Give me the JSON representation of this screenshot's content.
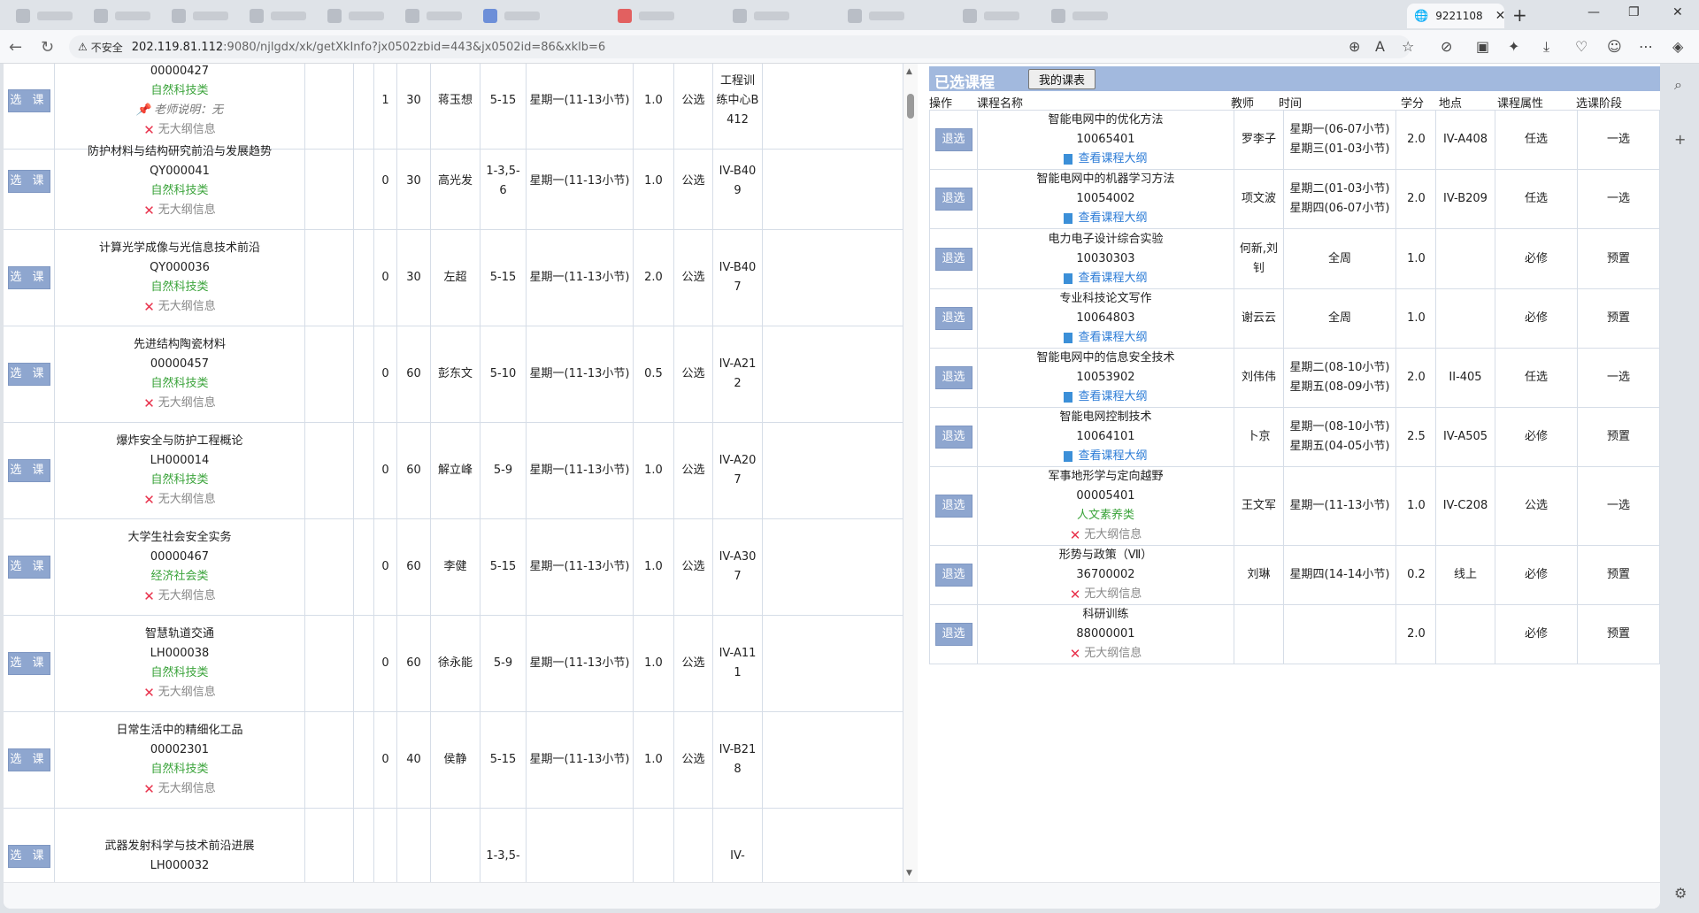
{
  "browser": {
    "active_tab_title": "9221108",
    "security_label": "不安全",
    "url_host": "202.119.81.112",
    "url_rest": ":9080/njlgdx/xk/getXkInfo?jx0502zbid=443&jx0502id=86&xklb=6"
  },
  "left_list": {
    "select_label": "选 课",
    "no_outline": "无大纲信息",
    "rows": [
      {
        "name": "",
        "code": "00000427",
        "category": "自然科技类",
        "note": "老师说明：无",
        "selected": "1",
        "capacity": "30",
        "teacher": "蒋玉想",
        "weeks": "5-15",
        "time": "星期一(11-13小节)",
        "credit": "1.0",
        "attr": "公选",
        "location": "工程训练中心B412"
      },
      {
        "name": "防护材料与结构研究前沿与发展趋势",
        "code": "QY000041",
        "category": "自然科技类",
        "note": "",
        "selected": "0",
        "capacity": "30",
        "teacher": "高光发",
        "weeks": "1-3,5-6",
        "time": "星期一(11-13小节)",
        "credit": "1.0",
        "attr": "公选",
        "location": "IV-B409"
      },
      {
        "name": "计算光学成像与光信息技术前沿",
        "code": "QY000036",
        "category": "自然科技类",
        "note": "",
        "selected": "0",
        "capacity": "30",
        "teacher": "左超",
        "weeks": "5-15",
        "time": "星期一(11-13小节)",
        "credit": "2.0",
        "attr": "公选",
        "location": "IV-B407"
      },
      {
        "name": "先进结构陶瓷材料",
        "code": "00000457",
        "category": "自然科技类",
        "note": "",
        "selected": "0",
        "capacity": "60",
        "teacher": "彭东文",
        "weeks": "5-10",
        "time": "星期一(11-13小节)",
        "credit": "0.5",
        "attr": "公选",
        "location": "IV-A212"
      },
      {
        "name": "爆炸安全与防护工程概论",
        "code": "LH000014",
        "category": "自然科技类",
        "note": "",
        "selected": "0",
        "capacity": "60",
        "teacher": "解立峰",
        "weeks": "5-9",
        "time": "星期一(11-13小节)",
        "credit": "1.0",
        "attr": "公选",
        "location": "IV-A207"
      },
      {
        "name": "大学生社会安全实务",
        "code": "00000467",
        "category": "经济社会类",
        "note": "",
        "selected": "0",
        "capacity": "60",
        "teacher": "李健",
        "weeks": "5-15",
        "time": "星期一(11-13小节)",
        "credit": "1.0",
        "attr": "公选",
        "location": "IV-A307"
      },
      {
        "name": "智慧轨道交通",
        "code": "LH000038",
        "category": "自然科技类",
        "note": "",
        "selected": "0",
        "capacity": "60",
        "teacher": "徐永能",
        "weeks": "5-9",
        "time": "星期一(11-13小节)",
        "credit": "1.0",
        "attr": "公选",
        "location": "IV-A111"
      },
      {
        "name": "日常生活中的精细化工品",
        "code": "00002301",
        "category": "自然科技类",
        "note": "",
        "selected": "0",
        "capacity": "40",
        "teacher": "侯静",
        "weeks": "5-15",
        "time": "星期一(11-13小节)",
        "credit": "1.0",
        "attr": "公选",
        "location": "IV-B218"
      },
      {
        "name": "武器发射科学与技术前沿进展",
        "code": "LH000032",
        "category": "",
        "note": "",
        "selected": "",
        "capacity": "",
        "teacher": "",
        "weeks": "1-3,5-",
        "time": "",
        "credit": "",
        "attr": "",
        "location": "IV-"
      }
    ]
  },
  "selected_panel": {
    "title": "已选课程",
    "my_schedule_button": "我的课表",
    "headers": {
      "op": "操作",
      "name": "课程名称",
      "teacher": "教师",
      "time": "时间",
      "credit": "学分",
      "location": "地点",
      "attr": "课程属性",
      "stage": "选课阶段"
    },
    "drop_label": "退选",
    "view_outline": "查看课程大纲",
    "no_outline": "无大纲信息",
    "rows": [
      {
        "name": "智能电网中的优化方法",
        "code": "10065401",
        "extra": "outline",
        "teacher": "罗李子",
        "time1": "星期一(06-07小节)",
        "time2": "星期三(01-03小节)",
        "credit": "2.0",
        "location": "IV-A408",
        "attr": "任选",
        "stage": "一选"
      },
      {
        "name": "智能电网中的机器学习方法",
        "code": "10054002",
        "extra": "outline",
        "teacher": "项文波",
        "time1": "星期二(01-03小节)",
        "time2": "星期四(06-07小节)",
        "credit": "2.0",
        "location": "IV-B209",
        "attr": "任选",
        "stage": "一选"
      },
      {
        "name": "电力电子设计综合实验",
        "code": "10030303",
        "extra": "outline",
        "teacher": "何新,刘钊",
        "time1": "全周",
        "time2": "",
        "credit": "1.0",
        "location": "",
        "attr": "必修",
        "stage": "预置"
      },
      {
        "name": "专业科技论文写作",
        "code": "10064803",
        "extra": "outline",
        "teacher": "谢云云",
        "time1": "全周",
        "time2": "",
        "credit": "1.0",
        "location": "",
        "attr": "必修",
        "stage": "预置"
      },
      {
        "name": "智能电网中的信息安全技术",
        "code": "10053902",
        "extra": "outline",
        "teacher": "刘伟伟",
        "time1": "星期二(08-10小节)",
        "time2": "星期五(08-09小节)",
        "credit": "2.0",
        "location": "II-405",
        "attr": "任选",
        "stage": "一选"
      },
      {
        "name": "智能电网控制技术",
        "code": "10064101",
        "extra": "outline",
        "teacher": "卜京",
        "time1": "星期一(08-10小节)",
        "time2": "星期五(04-05小节)",
        "credit": "2.5",
        "location": "IV-A505",
        "attr": "必修",
        "stage": "预置"
      },
      {
        "name": "军事地形学与定向越野",
        "code": "00005401",
        "extra": "category",
        "category": "人文素养类",
        "teacher": "王文军",
        "time1": "星期一(11-13小节)",
        "time2": "",
        "credit": "1.0",
        "location": "IV-C208",
        "attr": "公选",
        "stage": "一选"
      },
      {
        "name": "形势与政策（Ⅶ）",
        "code": "36700002",
        "extra": "none",
        "teacher": "刘琳",
        "time1": "星期四(14-14小节)",
        "time2": "",
        "credit": "0.2",
        "location": "线上",
        "attr": "必修",
        "stage": "预置"
      },
      {
        "name": "科研训练",
        "code": "88000001",
        "extra": "none",
        "teacher": "",
        "time1": "",
        "time2": "",
        "credit": "2.0",
        "location": "",
        "attr": "必修",
        "stage": "预置"
      }
    ]
  }
}
